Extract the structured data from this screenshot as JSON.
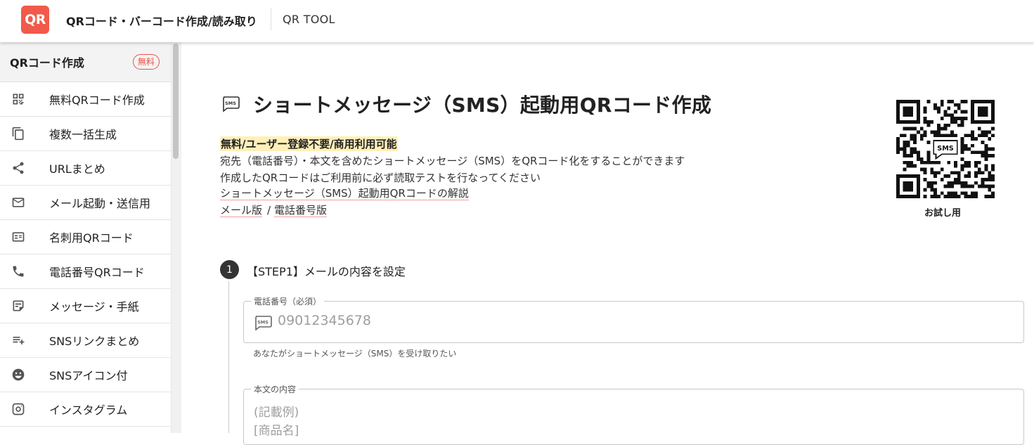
{
  "header": {
    "logo_text": "QR",
    "site_title": "QRコード・バーコード作成/読み取り",
    "site_sub": "QR TOOL",
    "logo_color": "#f15a4a"
  },
  "sidebar": {
    "section_title": "QRコード作成",
    "free_badge": "無料",
    "items": [
      {
        "label": "無料QRコード作成",
        "icon": "qr-grid-icon"
      },
      {
        "label": "複数一括生成",
        "icon": "copy-icon"
      },
      {
        "label": "URLまとめ",
        "icon": "share-icon"
      },
      {
        "label": "メール起動・送信用",
        "icon": "mail-icon"
      },
      {
        "label": "名刺用QRコード",
        "icon": "contact-card-icon"
      },
      {
        "label": "電話番号QRコード",
        "icon": "phone-icon"
      },
      {
        "label": "メッセージ・手紙",
        "icon": "note-icon"
      },
      {
        "label": "SNSリンクまとめ",
        "icon": "playlist-add-icon"
      },
      {
        "label": "SNSアイコン付",
        "icon": "smiley-icon"
      },
      {
        "label": "インスタグラム",
        "icon": "instagram-icon"
      }
    ]
  },
  "main": {
    "title": "ショートメッセージ（SMS）起動用QRコード作成",
    "highlight": "無料/ユーザー登録不要/商用利用可能",
    "desc1": "宛先（電話番号）・本文を含めたショートメッセージ（SMS）をQRコード化をすることができます",
    "desc2": "作成したQRコードはご利用前に必ず読取テストを行なってください",
    "link1": "ショートメッセージ（SMS）起動用QRコードの解説",
    "link2a": "メール版",
    "link_sep": "/",
    "link2b": "電話番号版",
    "qr_caption": "お試し用",
    "qr_center_text": "SMS"
  },
  "step1": {
    "number": "1",
    "label": "【STEP1】メールの内容を設定",
    "phone_legend": "電話番号（必須）",
    "phone_placeholder": "09012345678",
    "phone_hint": "あなたがショートメッセージ（SMS）を受け取りたい",
    "body_legend": "本文の内容",
    "body_line1": "(記載例)",
    "body_line2": "[商品名]"
  }
}
